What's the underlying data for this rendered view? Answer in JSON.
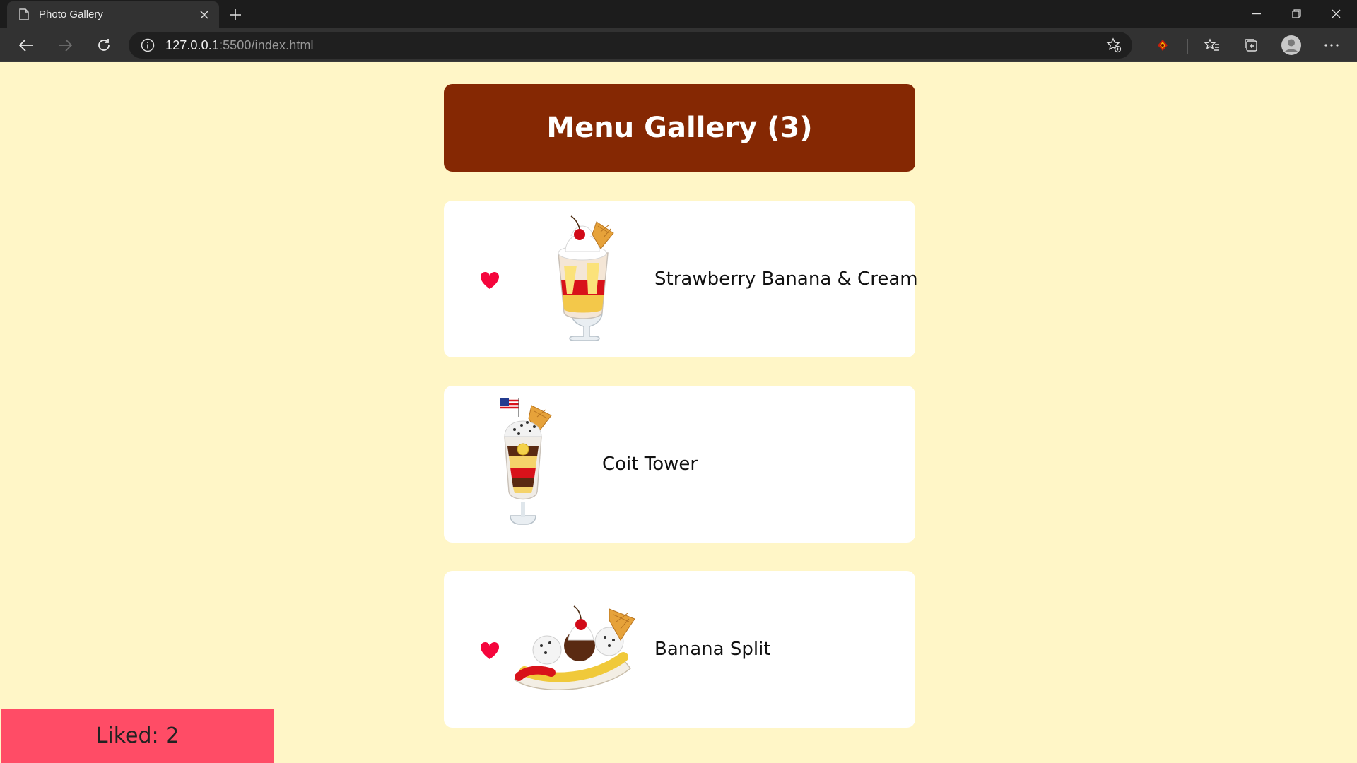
{
  "browser": {
    "tab_title": "Photo Gallery",
    "url_host": "127.0.0.1",
    "url_rest": ":5500/index.html"
  },
  "gallery": {
    "title": "Menu Gallery (3)",
    "items": [
      {
        "name": "Strawberry Banana & Cream",
        "liked": true,
        "image": "strawberry-sundae-glass"
      },
      {
        "name": "Coit Tower",
        "liked": false,
        "image": "tall-parfait-with-flag"
      },
      {
        "name": "Banana Split",
        "liked": true,
        "image": "banana-split-boat"
      }
    ]
  },
  "liked": {
    "label": "Liked: 2"
  },
  "colors": {
    "page_bg": "#fff6c7",
    "header_bg": "#852803",
    "heart": "#f5053c",
    "liked_badge": "#ff4c66"
  }
}
